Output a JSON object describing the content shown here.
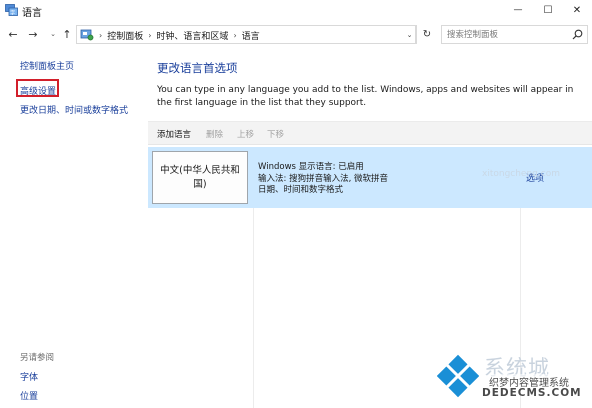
{
  "window": {
    "title": "语言",
    "min_glyph": "—",
    "max_glyph": "☐",
    "close_glyph": "✕"
  },
  "nav": {
    "back_glyph": "←",
    "forward_glyph": "→",
    "history_glyph": "⌄",
    "up_glyph": "↑",
    "breadcrumbs": [
      "控制面板",
      "时钟、语言和区域",
      "语言"
    ],
    "breadcrumb_sep": "›",
    "dropdown_glyph": "⌄",
    "refresh_glyph": "↻",
    "search_placeholder": "搜索控制面板"
  },
  "sidebar": {
    "home": "控制面板主页",
    "advanced": "高级设置",
    "date_time": "更改日期、时间或数字格式",
    "see_also": "另请参阅",
    "fonts": "字体",
    "location": "位置"
  },
  "main": {
    "title": "更改语言首选项",
    "description": "You can type in any language you add to the list. Windows, apps and websites will appear in the first language in the list that they support.",
    "toolbar": {
      "add": "添加语言",
      "remove": "删除",
      "move_up": "上移",
      "move_down": "下移"
    },
    "language": {
      "name": "中文(中华人民共和国)",
      "display_status": "Windows 显示语言: 已启用",
      "input_methods": "输入法: 搜狗拼音输入法, 微软拼音",
      "formats": "日期、时间和数字格式",
      "options": "选项"
    }
  },
  "watermark": {
    "brand": "系统城",
    "cms": "织梦内容管理系统",
    "domain": "DEDECMS.COM",
    "domain_left": "xitongcheng.com"
  },
  "colors": {
    "link": "#1a3f9b",
    "selection": "#cce8ff",
    "highlight_box": "#d21f2b"
  }
}
